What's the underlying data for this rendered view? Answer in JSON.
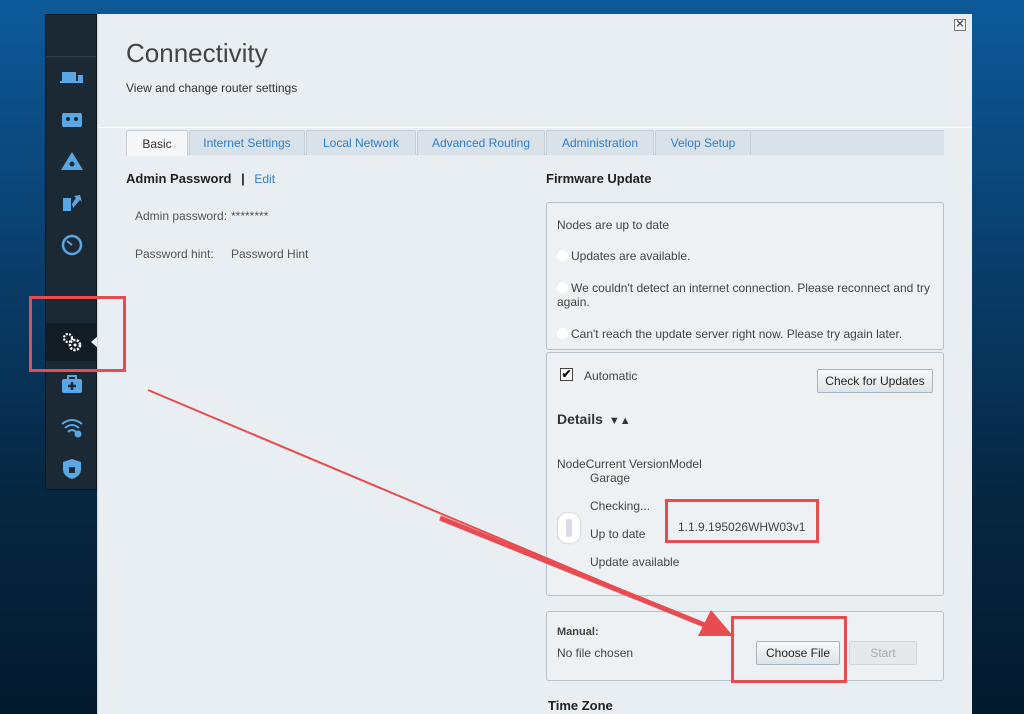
{
  "panel": {
    "title": "Connectivity",
    "subtitle": "View and change router settings",
    "close_glyph": "✕"
  },
  "sidebar": {
    "items": [
      {
        "icon": "devices-icon"
      },
      {
        "icon": "parental-controls-icon"
      },
      {
        "icon": "network-map-icon"
      },
      {
        "icon": "media-prioritization-icon"
      },
      {
        "icon": "speed-test-icon"
      },
      {
        "icon": "connectivity-gear-icon",
        "active": true
      },
      {
        "icon": "troubleshooting-icon"
      },
      {
        "icon": "wireless-icon"
      },
      {
        "icon": "security-icon"
      }
    ]
  },
  "tabs": [
    {
      "label": "Basic",
      "active": true
    },
    {
      "label": "Internet Settings"
    },
    {
      "label": "Local Network"
    },
    {
      "label": "Advanced Routing"
    },
    {
      "label": "Administration"
    },
    {
      "label": "Velop Setup"
    }
  ],
  "admin": {
    "heading": "Admin Password",
    "separator": "|",
    "edit_label": "Edit",
    "password_label": "Admin password:",
    "password_value": "********",
    "hint_label": "Password hint:",
    "hint_value": "Password Hint"
  },
  "firmware": {
    "heading": "Firmware Update",
    "statuses": [
      "Nodes are up to date",
      "Updates are available.",
      "We couldn't detect an internet connection. Please reconnect and try again.",
      "Can't reach the update server right now. Please try again later."
    ],
    "automatic_label": "Automatic",
    "automatic_checked": "✔",
    "check_updates_label": "Check for Updates",
    "details_label": "Details",
    "details_toggle": "▼▲",
    "table_header": "NodeCurrent VersionModel",
    "node_name": "Garage",
    "checking": "Checking...",
    "up_to_date": "Up to date",
    "version": "1.1.9.195026WHW03v1",
    "update_available": "Update available",
    "manual_label": "Manual:",
    "no_file": "No file chosen",
    "choose_file_label": "Choose File",
    "start_label": "Start"
  },
  "timezone": {
    "heading": "Time Zone"
  },
  "colors": {
    "accent_link": "#2e7ec7",
    "annotation": "#e84b50"
  }
}
